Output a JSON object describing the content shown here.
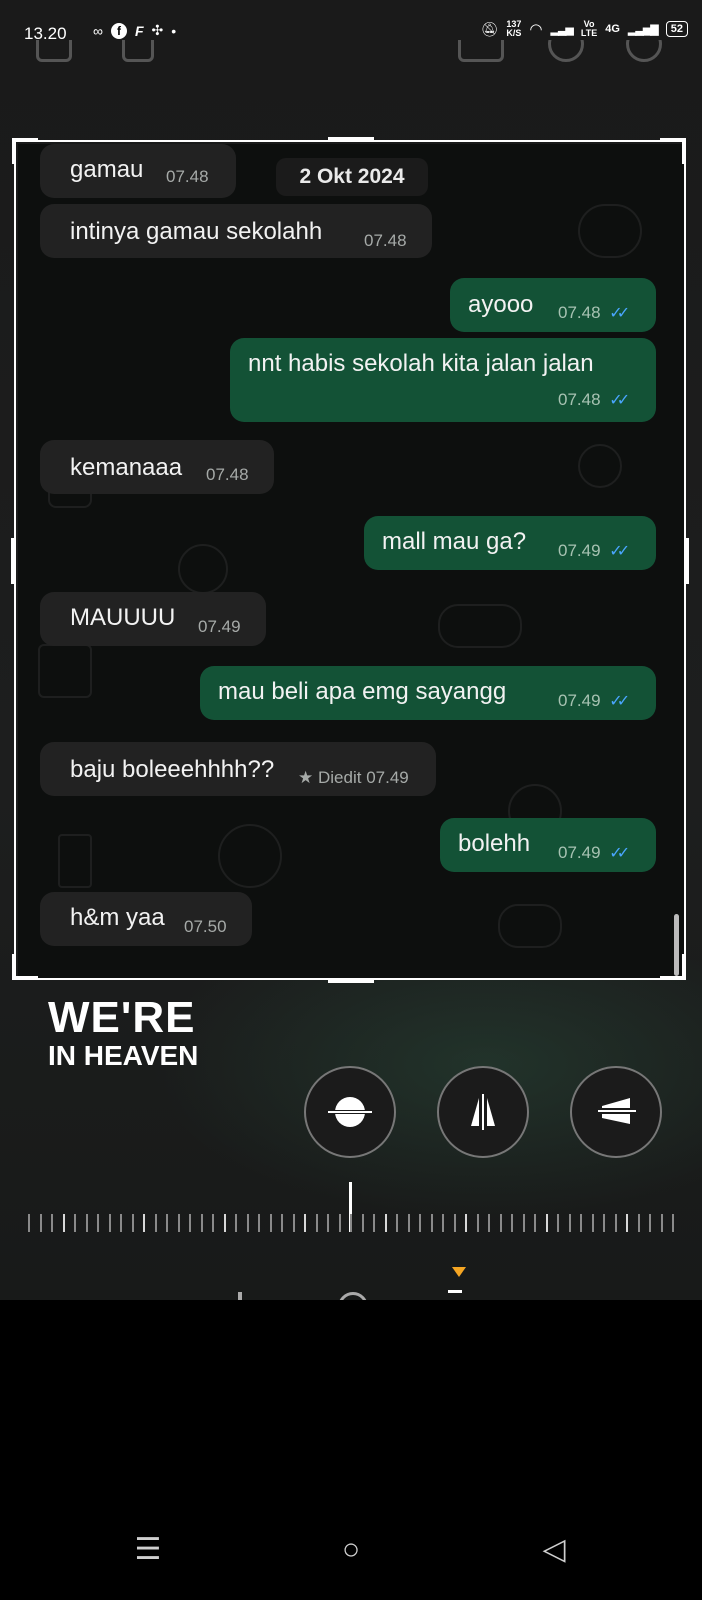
{
  "status_bar": {
    "time": "13.20",
    "net_speed_value": "137",
    "net_speed_unit": "K/S",
    "volte_top": "Vo",
    "volte_bottom": "LTE",
    "network": "4G",
    "battery": "52"
  },
  "chat": {
    "date_chip": "2 Okt 2024",
    "messages": [
      {
        "side": "in",
        "text": "gamau",
        "time": "07.48"
      },
      {
        "side": "in",
        "text": "intinya gamau sekolahh",
        "time": "07.48"
      },
      {
        "side": "out",
        "text": "ayooo",
        "time": "07.48"
      },
      {
        "side": "out",
        "text": "nnt habis sekolah kita jalan jalan",
        "time": "07.48"
      },
      {
        "side": "in",
        "text": "kemanaaa",
        "time": "07.48"
      },
      {
        "side": "out",
        "text": "mall mau ga?",
        "time": "07.49"
      },
      {
        "side": "in",
        "text": "MAUUUU",
        "time": "07.49"
      },
      {
        "side": "out",
        "text": "mau beli apa emg sayangg",
        "time": "07.49"
      },
      {
        "side": "in",
        "text": "baju boleeehhhh??",
        "time": "07.49",
        "edited_label": "Diedit"
      },
      {
        "side": "out",
        "text": "bolehh",
        "time": "07.49"
      },
      {
        "side": "in",
        "text": "h&m yaa",
        "time": "07.50"
      }
    ],
    "read_ticks": "✓✓"
  },
  "overlay": {
    "logo_line1": "WE'RE",
    "logo_line2": "IN HEAVEN"
  },
  "icons": {
    "horizon": "horizon-flip-icon",
    "vertical": "vertical-perspective-icon",
    "horizontal": "horizontal-perspective-icon"
  },
  "nav": {
    "menu": "☰",
    "home": "○",
    "back": "◁"
  },
  "colors": {
    "incoming_bubble": "#222222",
    "outgoing_bubble": "#135236",
    "read_tick": "#4aa6ff",
    "marker": "#f5a623"
  }
}
